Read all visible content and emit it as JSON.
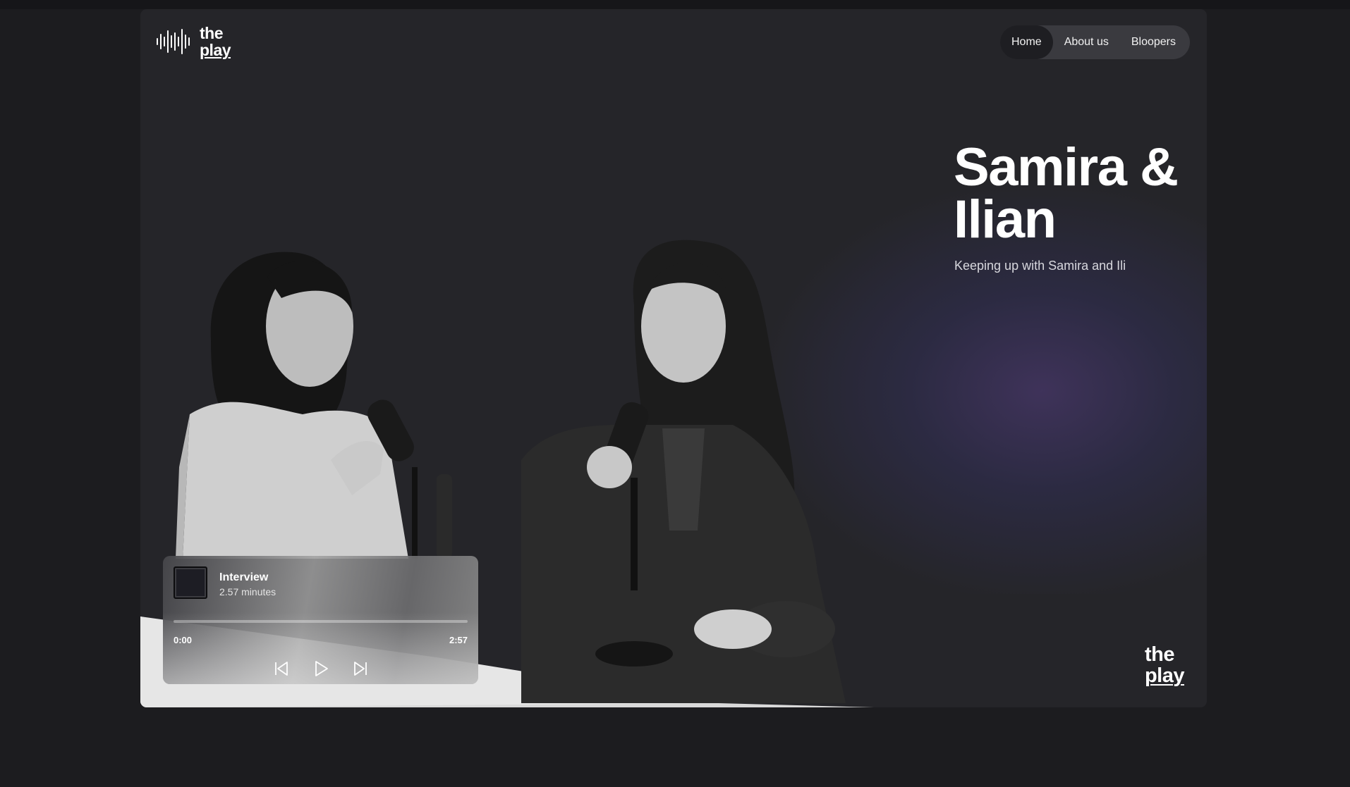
{
  "brand": {
    "line1": "the",
    "line2": "play"
  },
  "nav": {
    "items": [
      {
        "label": "Home"
      },
      {
        "label": "About us"
      },
      {
        "label": "Bloopers"
      }
    ]
  },
  "hero": {
    "title": "Samira & Ilian",
    "subtitle": "Keeping up with Samira and Ili"
  },
  "player": {
    "title": "Interview",
    "duration": "2.57 minutes",
    "current_time": "0:00",
    "total_time": "2:57",
    "progress": 0
  },
  "icons": {
    "logo": "waveform-icon",
    "prev": "skip-back-icon",
    "play": "play-icon",
    "next": "skip-forward-icon"
  },
  "colors": {
    "background": "#1c1c1f",
    "card": "#252529",
    "nav_pill": "#3a3a3f",
    "glow": "#543e82"
  }
}
